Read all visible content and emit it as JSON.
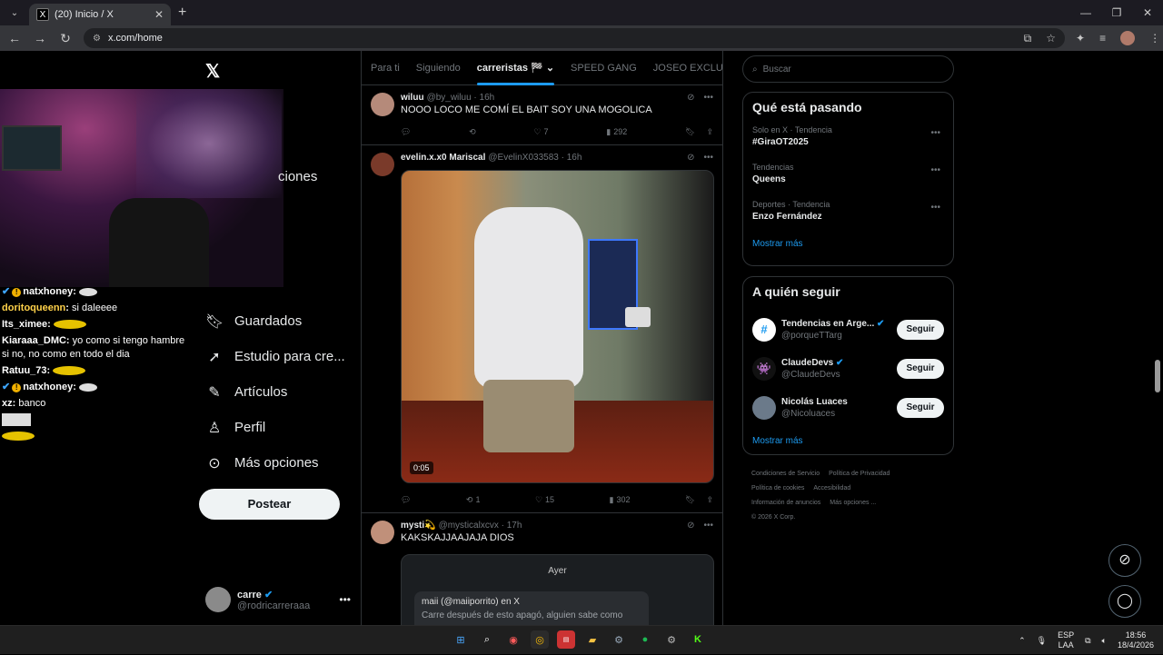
{
  "browser": {
    "tab_title": "(20) Inicio / X",
    "tab_favicon": "X",
    "url": "x.com/home"
  },
  "stream": {
    "chat": [
      {
        "user": "natxhoney",
        "user_color": "#ffffff",
        "message": "",
        "emote": "white",
        "verified": true
      },
      {
        "user": "doritoqueenn",
        "user_color": "#ffd24a",
        "message": "si daleeee",
        "emote": "",
        "verified": false
      },
      {
        "user": "Its_ximee",
        "user_color": "#ffffff",
        "message": "",
        "emote": "gold",
        "verified": false
      },
      {
        "user": "Kiaraaa_DMC",
        "user_color": "#ffffff",
        "message": "yo como si tengo hambre si no, no como en todo el dia",
        "emote": "",
        "verified": false
      },
      {
        "user": "Ratuu_73",
        "user_color": "#ffffff",
        "message": "",
        "emote": "gold",
        "verified": false
      },
      {
        "user": "natxhoney",
        "user_color": "#ffffff",
        "message": "",
        "emote": "white",
        "verified": true
      },
      {
        "user": "xz",
        "user_color": "#ffffff",
        "message": "banco",
        "emote": "",
        "verified": false
      }
    ]
  },
  "sidebar": {
    "partial_label": "ciones",
    "items": [
      {
        "label": "Guardados",
        "icon": "bookmark-icon"
      },
      {
        "label": "Estudio para cre...",
        "icon": "rocket-icon"
      },
      {
        "label": "Artículos",
        "icon": "article-icon"
      },
      {
        "label": "Perfil",
        "icon": "person-icon"
      },
      {
        "label": "Más opciones",
        "icon": "more-circle-icon"
      }
    ],
    "post_button": "Postear",
    "account": {
      "name": "carre",
      "handle": "@rodricarreraaa"
    }
  },
  "timeline": {
    "tabs": [
      "Para ti",
      "Siguiendo",
      "carreristas 🏁",
      "SPEED GANG",
      "JOSEO EXCLUSIV"
    ],
    "active_tab": 2,
    "tweets": [
      {
        "name": "wiluu",
        "handle": "@by_wiluu",
        "time": "16h",
        "text": "NOOO LOCO ME COMÍ EL BAIT SOY UNA MOGOLICA",
        "replies": "",
        "retweets": "",
        "likes": "7",
        "views": "292"
      },
      {
        "name": "evelin.x.x0 Mariscal",
        "handle": "@EvelinX033583",
        "time": "16h",
        "text": "",
        "video_time": "0:05",
        "replies": "",
        "retweets": "1",
        "likes": "15",
        "views": "302"
      },
      {
        "name": "mysti💫",
        "handle": "@mysticalxcvx",
        "time": "17h",
        "text": "KAKSKAJJAAJAJA DIOS",
        "dm_day": "Ayer",
        "dm_sender": "maii (@maiiporrito) en X",
        "dm_preview": "Carre después de esto apagó, alguien sabe como"
      }
    ]
  },
  "right": {
    "search_placeholder": "Buscar",
    "trends_title": "Qué está pasando",
    "trends": [
      {
        "context": "Solo en X · Tendencia",
        "name": "#GiraOT2025"
      },
      {
        "context": "Tendencias",
        "name": "Queens"
      },
      {
        "context": "Deportes · Tendencia",
        "name": "Enzo Fernández"
      }
    ],
    "show_more": "Mostrar más",
    "who_title": "A quién seguir",
    "who": [
      {
        "name": "Tendencias en Arge...",
        "handle": "@porqueTTarg",
        "avatar": "#"
      },
      {
        "name": "ClaudeDevs",
        "handle": "@ClaudeDevs",
        "avatar": "👾"
      },
      {
        "name": "Nicolás Luaces",
        "handle": "@Nicoluaces",
        "avatar": ""
      }
    ],
    "follow_label": "Seguir",
    "footer": [
      "Condiciones de Servicio",
      "Política de Privacidad",
      "Política de cookies",
      "Accesibilidad",
      "Información de anuncios",
      "Más opciones ...",
      "© 2026 X Corp."
    ]
  },
  "taskbar": {
    "lang_top": "ESP",
    "lang_bottom": "LAA",
    "time": "18:56",
    "date": "18/4/2026"
  },
  "colors": {
    "accent": "#1d9bf0",
    "bg": "#000000",
    "border": "#2f3336"
  }
}
